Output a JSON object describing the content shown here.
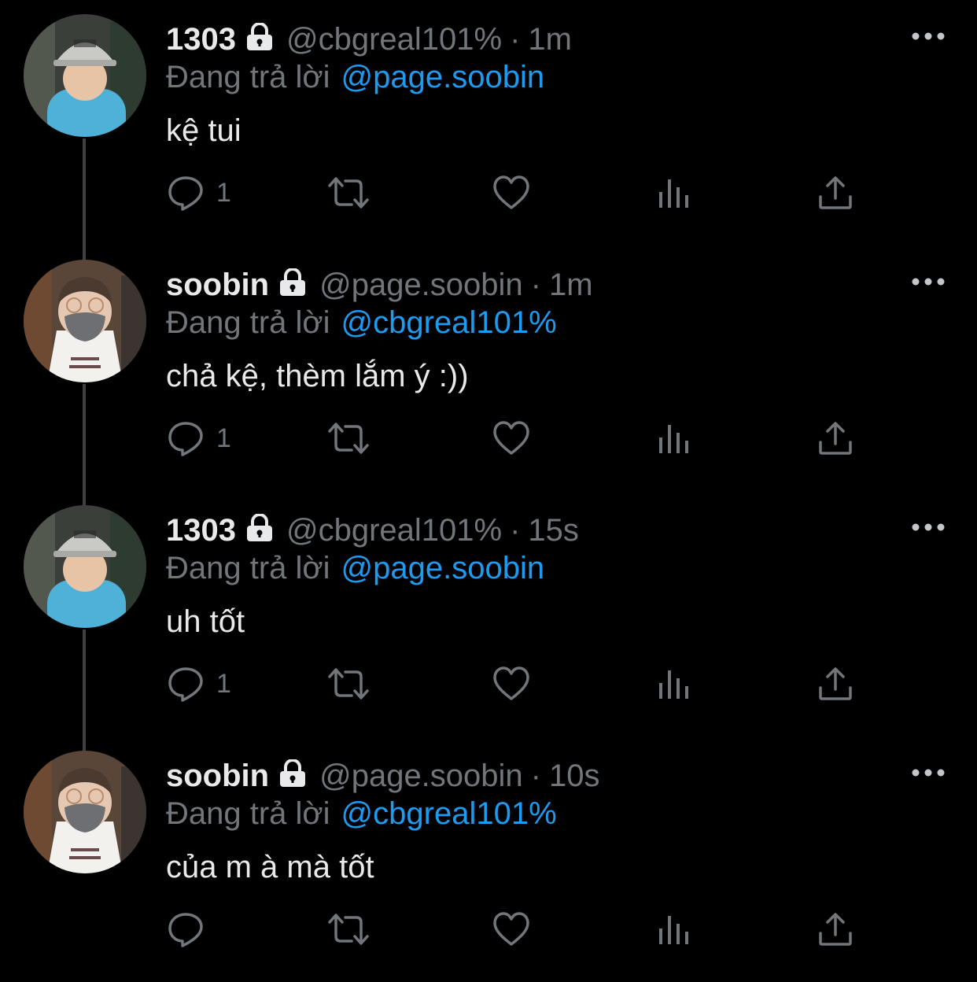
{
  "reply_label": "Đang trả lời",
  "tweets": [
    {
      "name": "1303",
      "handle": "@cbgreal101%",
      "separator": "·",
      "time": "1m",
      "reply_to": "@page.soobin",
      "text": "kệ tui",
      "reply_count": "1",
      "avatar": "boy-helmet-avatar"
    },
    {
      "name": "soobin",
      "handle": "@page.soobin",
      "separator": "·",
      "time": "1m",
      "reply_to": "@cbgreal101%",
      "text": "chả kệ, thèm lắm ý :))",
      "reply_count": "1",
      "avatar": "masked-man-avatar"
    },
    {
      "name": "1303",
      "handle": "@cbgreal101%",
      "separator": "·",
      "time": "15s",
      "reply_to": "@page.soobin",
      "text": "uh tốt",
      "reply_count": "1",
      "avatar": "boy-helmet-avatar"
    },
    {
      "name": "soobin",
      "handle": "@page.soobin",
      "separator": "·",
      "time": "10s",
      "reply_to": "@cbgreal101%",
      "text": "của m à mà tốt",
      "reply_count": "",
      "avatar": "masked-man-avatar"
    }
  ],
  "icons": {
    "reply": "reply-icon",
    "retweet": "retweet-icon",
    "like": "like-icon",
    "views": "views-icon",
    "share": "share-icon",
    "more": "more-icon",
    "lock": "lock-icon"
  },
  "colors": {
    "background": "#000000",
    "text": "#e7e9ea",
    "secondary": "#71767b",
    "accent": "#1d9bf0"
  }
}
